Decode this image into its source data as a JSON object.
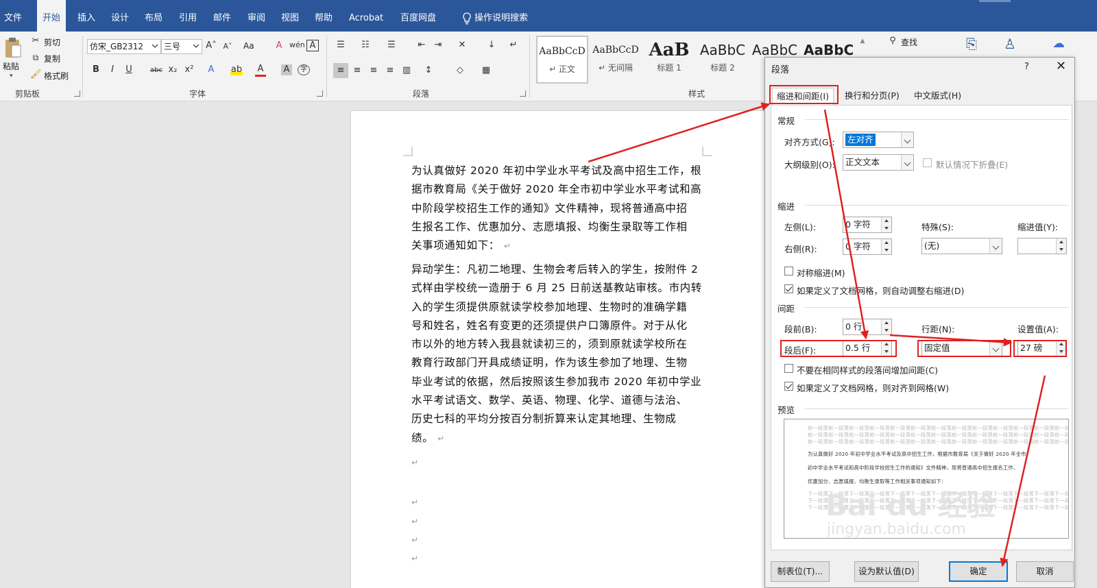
{
  "menubar": {
    "tabs": [
      "文件",
      "开始",
      "插入",
      "设计",
      "布局",
      "引用",
      "邮件",
      "审阅",
      "视图",
      "帮助",
      "Acrobat",
      "百度网盘"
    ],
    "active_tab": "开始",
    "search_label": "操作说明搜索",
    "bg_color": "#2b579a"
  },
  "ribbon": {
    "clipboard": {
      "paste": "粘贴",
      "cut": "剪切",
      "copy": "复制",
      "format_painter": "格式刷",
      "label": "剪贴板"
    },
    "font": {
      "name": "仿宋_GB2312",
      "size": "三号",
      "case_btn": "Aa",
      "label": "字体",
      "bold": "B",
      "italic": "I",
      "underline": "U",
      "strike": "abc",
      "sub": "x₂",
      "sup": "x²"
    },
    "paragraph": {
      "label": "段落"
    },
    "styles": {
      "label": "样式",
      "items": [
        {
          "sample": "AaBbCcD",
          "name": "↵ 正文"
        },
        {
          "sample": "AaBbCcD",
          "name": "↵ 无间隔"
        },
        {
          "sample": "AaB",
          "name": "标题 1"
        },
        {
          "sample": "AaBbC",
          "name": "标题 2"
        },
        {
          "sample": "AaBbC",
          "name": ""
        },
        {
          "sample": "AaBbC",
          "name": ""
        }
      ]
    },
    "editing": {
      "find": "查找"
    }
  },
  "document": {
    "paragraph1": [
      "为认真做好 2020 年初中学业水平考试及高中招生工作，根",
      "据市教育局《关于做好 2020 年全市初中学业水平考试和高",
      "中阶段学校招生工作的通知》文件精神，现将普通高中招",
      "生报名工作、优惠加分、志愿填报、均衡生录取等工作相",
      "关事项通知如下："
    ],
    "paragraph2": [
      "异动学生：凡初二地理、生物会考后转入的学生，按附件 2",
      "式样由学校统一造册于 6 月 25 日前送基教站审核。市内转",
      "入的学生须提供原就读学校参加地理、生物时的准确学籍",
      "号和姓名，姓名有变更的还须提供户口簿原件。对于从化",
      "市以外的地方转入我县就读初三的，须到原就读学校所在",
      "教育行政部门开具成绩证明，作为该生参加了地理、生物",
      "毕业考试的依据，然后按照该生参加我市 2020 年初中学业",
      "水平考试语文、数学、英语、物理、化学、道德与法治、",
      "历史七科的平均分按百分制折算来认定其地理、生物成",
      "绩。"
    ],
    "para_mark": "↵"
  },
  "dialog": {
    "title": "段落",
    "help": "?",
    "close": "✕",
    "tabs": [
      "缩进和间距(I)",
      "换行和分页(P)",
      "中文版式(H)"
    ],
    "active_tab": "缩进和间距(I)",
    "general": {
      "section": "常规",
      "alignment_label": "对齐方式(G):",
      "alignment_value": "左对齐",
      "outline_label": "大纲级别(O):",
      "outline_value": "正文文本",
      "collapse_label": "默认情况下折叠(E)"
    },
    "indent": {
      "section": "缩进",
      "left_label": "左侧(L):",
      "left_value": "0 字符",
      "right_label": "右侧(R):",
      "right_value": "0 字符",
      "special_label": "特殊(S):",
      "special_value": "(无)",
      "indent_by_label": "缩进值(Y):",
      "indent_by_value": "",
      "mirror_label": "对称缩进(M)",
      "auto_adjust_label": "如果定义了文档网格，则自动调整右缩进(D)"
    },
    "spacing": {
      "section": "间距",
      "before_label": "段前(B):",
      "before_value": "0 行",
      "after_label": "段后(F):",
      "after_value": "0.5 行",
      "line_label": "行距(N):",
      "line_value": "固定值",
      "at_label": "设置值(A):",
      "at_value": "27 磅",
      "no_space_label": "不要在相同样式的段落间增加间距(C)",
      "snap_grid_label": "如果定义了文档网格，则对齐到网格(W)"
    },
    "preview": {
      "section": "预览",
      "prev_text": "前一段落前一段落前一段落前一段落前一段落前一段落前一段落前一段落前一段落前一段落前一段落前一段落前一段落",
      "sample_lines": [
        "为认真做好 2020 年初中学业水平考试及高中招生工作，根据市教育局《关于做好 2020 年全市",
        "初中学业水平考试和高中阶段学校招生工作的通知》文件精神，现将普通高中招生报名工作、",
        "优惠加分、志愿填报、均衡生录取等工作相关事项通知如下："
      ],
      "next_text": "下一段落下一段落下一段落下一段落下一段落下一段落下一段落下一段落下一段落下一段落下一段落下一段落下一段落"
    },
    "buttons": {
      "tabs": "制表位(T)...",
      "set_default": "设为默认值(D)",
      "ok": "确定",
      "cancel": "取消"
    }
  },
  "watermark": {
    "logo": "Bai du 经验",
    "url": "jingyan.baidu.com"
  },
  "annotation_color": "#e02020"
}
